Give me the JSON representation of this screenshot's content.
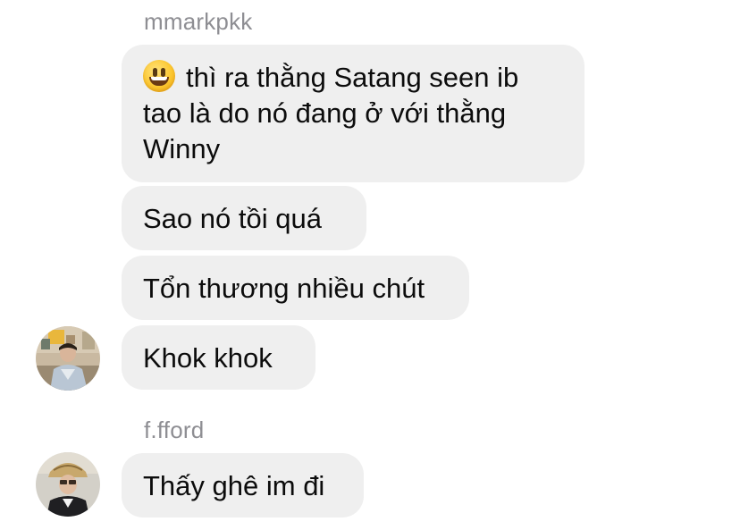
{
  "thread": {
    "messages": [
      {
        "sender": "mmarkpkk"
      },
      {
        "emoji": "grinning-face-emoji",
        "text": "thì ra thằng Satang seen ib tao là do nó đang ở với thằng Winny"
      },
      {
        "text": "Sao nó tồi quá"
      },
      {
        "text": "Tổn thương nhiều chút"
      },
      {
        "text": "Khok khok"
      },
      {
        "sender": "f.fford"
      },
      {
        "text": "Thấy ghê im đi"
      }
    ]
  },
  "colors": {
    "bubble_bg": "#efefef",
    "sender_text": "#8e8e93",
    "message_text": "#0c0c0c"
  }
}
